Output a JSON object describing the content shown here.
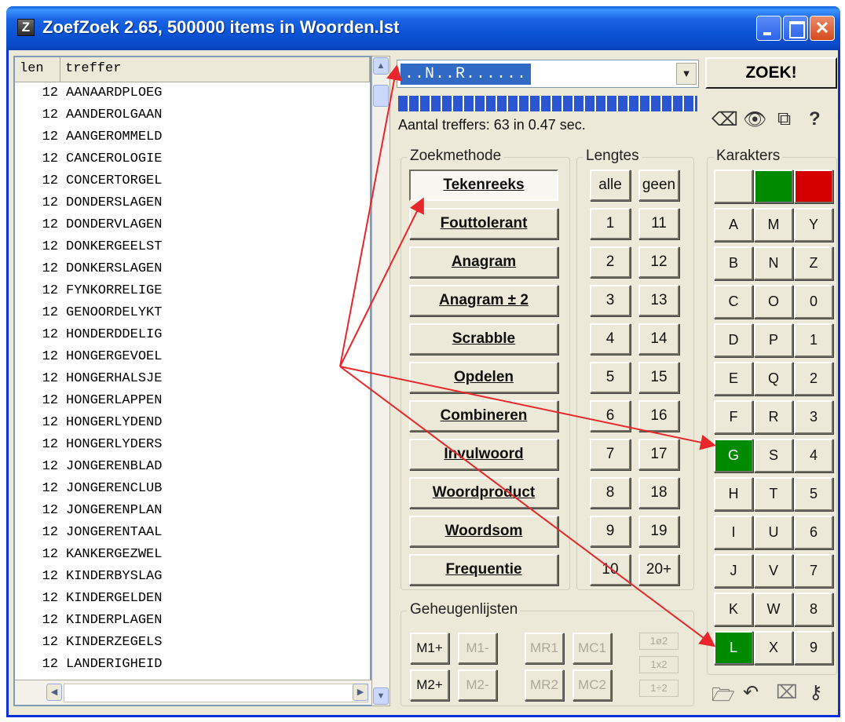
{
  "window": {
    "title": "ZoefZoek 2.65, 500000 items in Woorden.lst",
    "app_icon_letter": "Z",
    "close_glyph": "✕"
  },
  "list": {
    "headers": {
      "len": "len",
      "treffer": "treffer"
    },
    "rows": [
      {
        "len": "12",
        "word": "AANAARDPLOEG"
      },
      {
        "len": "12",
        "word": "AANDEROLGAAN"
      },
      {
        "len": "12",
        "word": "AANGEROMMELD"
      },
      {
        "len": "12",
        "word": "CANCEROLOGIE"
      },
      {
        "len": "12",
        "word": "CONCERTORGEL"
      },
      {
        "len": "12",
        "word": "DONDERSLAGEN"
      },
      {
        "len": "12",
        "word": "DONDERVLAGEN"
      },
      {
        "len": "12",
        "word": "DONKERGEELST"
      },
      {
        "len": "12",
        "word": "DONKERSLAGEN"
      },
      {
        "len": "12",
        "word": "FYNKORRELIGE"
      },
      {
        "len": "12",
        "word": "GENOORDELYKT"
      },
      {
        "len": "12",
        "word": "HONDERDDELIG"
      },
      {
        "len": "12",
        "word": "HONGERGEVOEL"
      },
      {
        "len": "12",
        "word": "HONGERHALSJE"
      },
      {
        "len": "12",
        "word": "HONGERLAPPEN"
      },
      {
        "len": "12",
        "word": "HONGERLYDEND"
      },
      {
        "len": "12",
        "word": "HONGERLYDERS"
      },
      {
        "len": "12",
        "word": "JONGERENBLAD"
      },
      {
        "len": "12",
        "word": "JONGERENCLUB"
      },
      {
        "len": "12",
        "word": "JONGERENPLAN"
      },
      {
        "len": "12",
        "word": "JONGERENTAAL"
      },
      {
        "len": "12",
        "word": "KANKERGEZWEL"
      },
      {
        "len": "12",
        "word": "KINDERBYSLAG"
      },
      {
        "len": "12",
        "word": "KINDERGELDEN"
      },
      {
        "len": "12",
        "word": "KINDERPLAGEN"
      },
      {
        "len": "12",
        "word": "KINDERZEGELS"
      },
      {
        "len": "12",
        "word": "LANDERIGHEID"
      }
    ]
  },
  "search": {
    "value": "..N..R......",
    "dropdown_glyph": "▼",
    "button": "ZOEK!"
  },
  "progress": {
    "fraction": 1.0
  },
  "status": {
    "text": "Aantal treffers: 63 in 0.47 sec."
  },
  "tools": {
    "icons": [
      "eraser-icon",
      "eye-icon",
      "copy-icon",
      "help-icon"
    ],
    "glyphs": [
      "⌫",
      "👁",
      "⧉",
      "?"
    ]
  },
  "zoekmethode": {
    "label": "Zoekmethode",
    "items": [
      "Tekenreeks",
      "Fouttolerant",
      "Anagram",
      "Anagram ± 2",
      "Scrabble",
      "Opdelen",
      "Combineren",
      "Invulwoord",
      "Woordproduct",
      "Woordsom",
      "Frequentie"
    ],
    "active": "Tekenreeks"
  },
  "lengtes": {
    "label": "Lengtes",
    "alle": "alle",
    "geen": "geen",
    "left": [
      "1",
      "2",
      "3",
      "4",
      "5",
      "6",
      "7",
      "8",
      "9",
      "10"
    ],
    "right": [
      "11",
      "12",
      "13",
      "14",
      "15",
      "16",
      "17",
      "18",
      "19",
      "20+"
    ]
  },
  "karakters": {
    "label": "Karakters",
    "colors": {
      "green": "#008a00",
      "red": "#d40000",
      "neutral": "#ece9d8"
    },
    "grid": [
      [
        "A",
        "M",
        "Y"
      ],
      [
        "B",
        "N",
        "Z"
      ],
      [
        "C",
        "O",
        "0"
      ],
      [
        "D",
        "P",
        "1"
      ],
      [
        "E",
        "Q",
        "2"
      ],
      [
        "F",
        "R",
        "3"
      ],
      [
        "G",
        "S",
        "4"
      ],
      [
        "H",
        "T",
        "5"
      ],
      [
        "I",
        "U",
        "6"
      ],
      [
        "J",
        "V",
        "7"
      ],
      [
        "K",
        "W",
        "8"
      ],
      [
        "L",
        "X",
        "9"
      ]
    ],
    "green_keys": [
      "G",
      "L"
    ]
  },
  "geheugen": {
    "label": "Geheugenlijsten",
    "row1": [
      "M1+",
      "M1-",
      "MR1",
      "MC1"
    ],
    "row2": [
      "M2+",
      "M2-",
      "MR2",
      "MC2"
    ],
    "small": [
      "1ø2",
      "1x2",
      "1÷2"
    ]
  },
  "bottom_icons": {
    "names": [
      "open-folder-icon",
      "undo-icon",
      "clear-icon",
      "key-icon"
    ],
    "glyphs": [
      "🗁",
      "↶",
      "⌧",
      "⚷"
    ]
  },
  "annotation": {
    "color": "#e8262b"
  }
}
